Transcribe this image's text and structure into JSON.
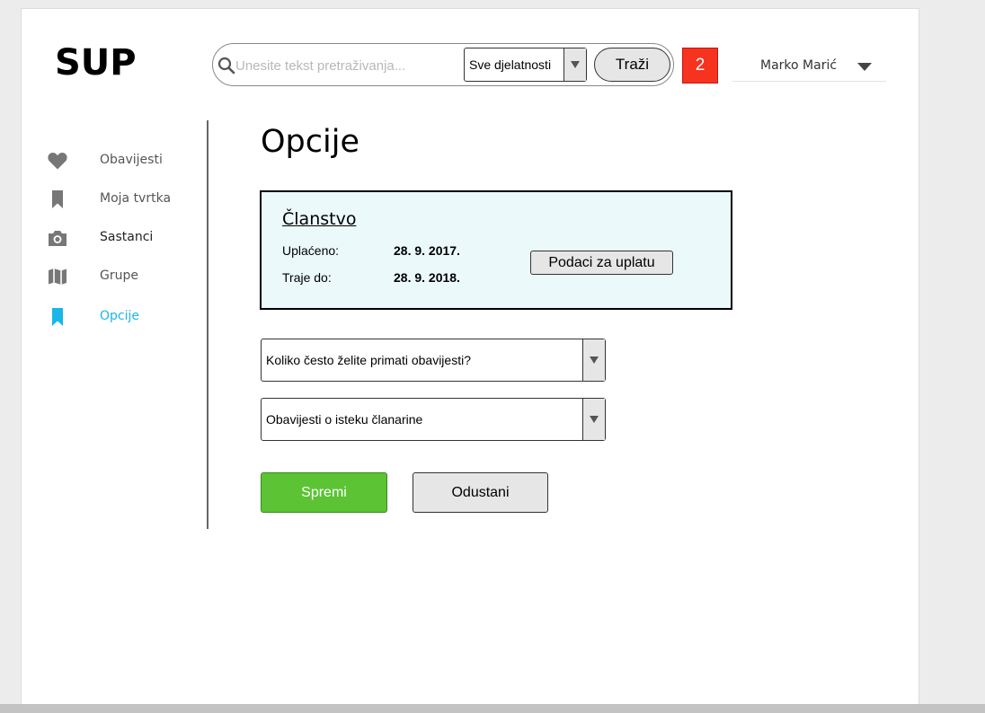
{
  "app": {
    "logo": "SUP"
  },
  "header": {
    "search": {
      "placeholder": "Unesite tekst pretraživanja...",
      "value": ""
    },
    "category": {
      "selected": "Sve djelatnosti"
    },
    "search_button": "Traži",
    "notification_count": "2",
    "user": {
      "name": "Marko Marić"
    }
  },
  "sidebar": {
    "items": [
      {
        "label": "Obavijesti",
        "icon": "heart-icon"
      },
      {
        "label": "Moja tvrtka",
        "icon": "bookmark-icon"
      },
      {
        "label": "Sastanci",
        "icon": "camera-icon"
      },
      {
        "label": "Grupe",
        "icon": "map-icon"
      },
      {
        "label": "Opcije",
        "icon": "bookmark-icon",
        "active": true
      }
    ]
  },
  "main": {
    "title": "Opcije",
    "membership": {
      "title": "Članstvo",
      "paid_label": "Uplaćeno:",
      "paid_value": "28. 9. 2017.",
      "valid_label": "Traje do:",
      "valid_value": "28. 9. 2018.",
      "payment_button": "Podaci za uplatu"
    },
    "dropdowns": [
      {
        "value": "Koliko često želite primati obavijesti?"
      },
      {
        "value": "Obavijesti o isteku članarine"
      }
    ],
    "save_button": "Spremi",
    "cancel_button": "Odustani"
  },
  "colors": {
    "accent": "#18b7e8",
    "save": "#5bc334",
    "badge": "#f5331f",
    "membership_bg": "#ebf9fa",
    "icon_gray": "#777777"
  }
}
